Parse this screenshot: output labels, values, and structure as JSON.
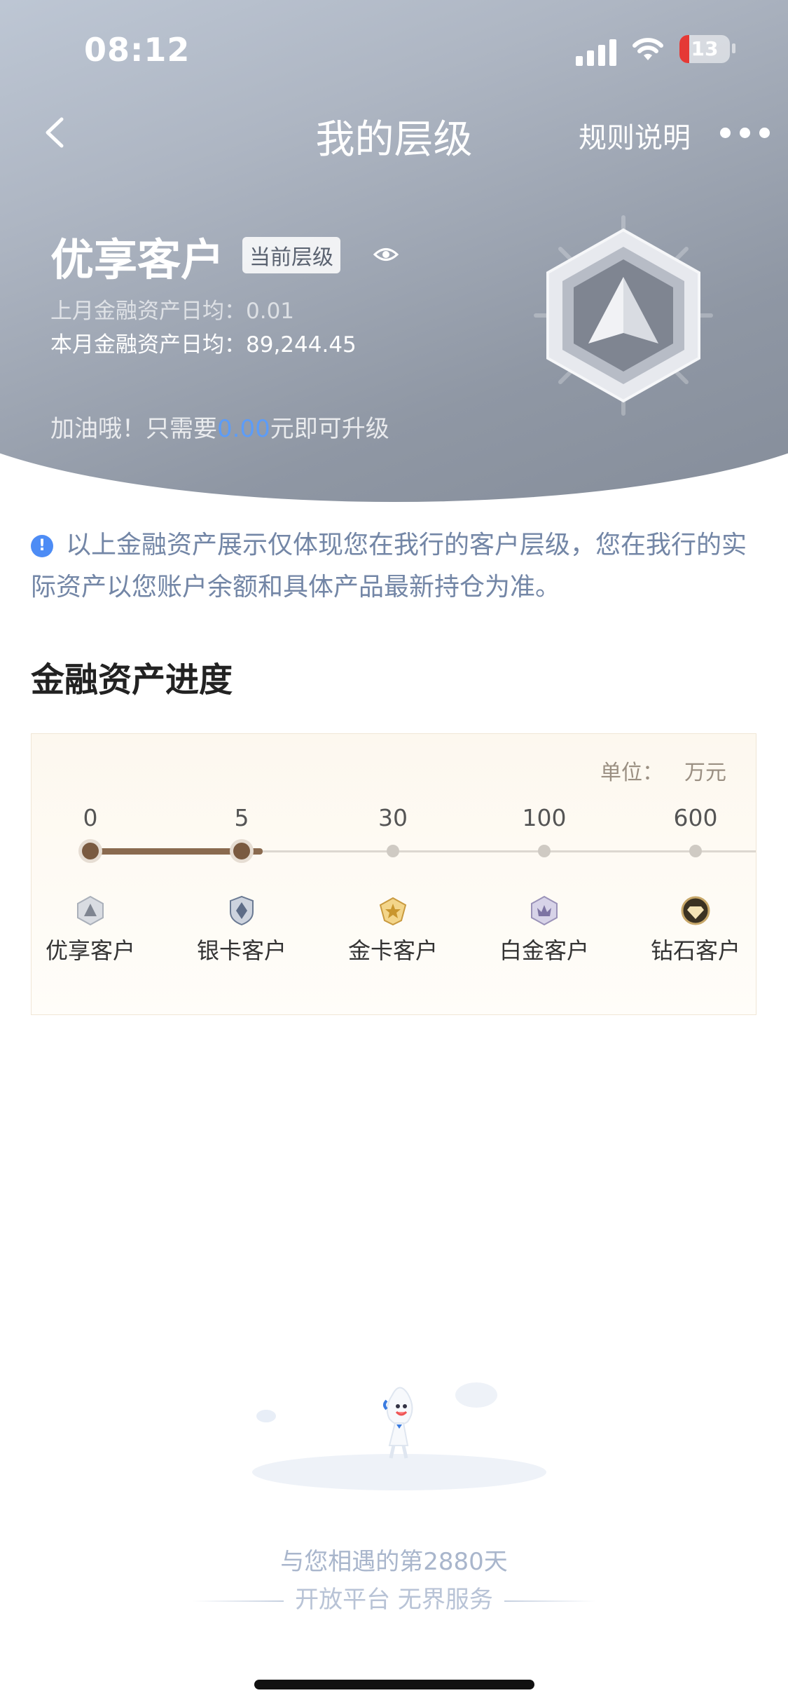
{
  "status_bar": {
    "time": "08:12",
    "battery": "13"
  },
  "nav": {
    "title": "我的层级",
    "rules_label": "规则说明"
  },
  "hero": {
    "tier_name": "优享客户",
    "current_badge": "当前层级",
    "last_month_label": "上月金融资产日均：",
    "last_month_value": "0.01",
    "this_month_label": "本月金融资产日均：",
    "this_month_value": "89,244.45",
    "upgrade_prefix": "加油哦！只需要",
    "upgrade_amount": "0.00",
    "upgrade_suffix": "元即可升级"
  },
  "notice": "以上金融资产展示仅体现您在我行的客户层级，您在我行的实际资产以您账户余额和具体产品最新持仓为准。",
  "progress": {
    "title": "金融资产进度",
    "unit_label": "单位：",
    "unit_value": "万元",
    "ticks": [
      "0",
      "5",
      "30",
      "100",
      "600"
    ],
    "current_tier_index": 1,
    "tiers": [
      {
        "label": "优享客户",
        "icon": "tier-basic-icon",
        "color": "#8e96a3"
      },
      {
        "label": "银卡客户",
        "icon": "tier-silver-icon",
        "color": "#6b7a93"
      },
      {
        "label": "金卡客户",
        "icon": "tier-gold-icon",
        "color": "#c99a3f"
      },
      {
        "label": "白金客户",
        "icon": "tier-platinum-icon",
        "color": "#9a92b8"
      },
      {
        "label": "钻石客户",
        "icon": "tier-diamond-icon",
        "color": "#4a3d2a"
      }
    ]
  },
  "footer": {
    "days": "与您相遇的第2880天",
    "slogan": "开放平台 无界服务"
  },
  "colors": {
    "accent_blue": "#5c9cf8",
    "notice_blue": "#4d8cf5",
    "progress_brown": "#8a6a4f"
  }
}
